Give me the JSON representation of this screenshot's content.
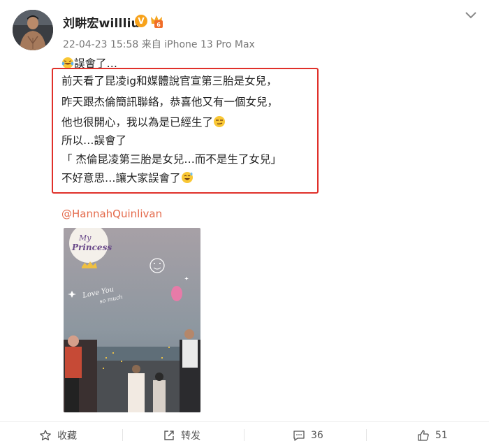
{
  "post": {
    "username": "刘畊宏willliu",
    "verified_badge": "V",
    "meta": "22-04-23 15:58  来自 iPhone 13 Pro Max",
    "first_line": "誤會了…",
    "lines": [
      "前天看了昆凌ig和媒體說官宣第三胎是女兒，",
      "昨天跟杰倫簡訊聯絡，恭喜他又有一個女兒，",
      "他也很開心，我以為是已經生了",
      "所以…誤會了",
      "「 杰倫昆凌第三胎是女兒…而不是生了女兒」",
      "不好意思…讓大家誤會了"
    ],
    "mention": "@HannahQuinlivan"
  },
  "photo": {
    "sticker_top": "My",
    "sticker_bottom": "Princess",
    "handwriting_1": "Love You",
    "handwriting_2": "so much"
  },
  "footer": {
    "favorite_label": "收藏",
    "repost_label": "转发",
    "comment_count": "36",
    "like_count": "51"
  },
  "colors": {
    "highlight_border": "#e0302a",
    "mention": "#e46a4b",
    "badge": "#f7a21b"
  },
  "icons": [
    "chevron-down-icon",
    "laughing-tears-emoji-icon",
    "smirk-emoji-icon",
    "sweat-smile-emoji-icon",
    "star-icon",
    "repost-icon",
    "comment-icon",
    "thumbs-up-icon"
  ]
}
